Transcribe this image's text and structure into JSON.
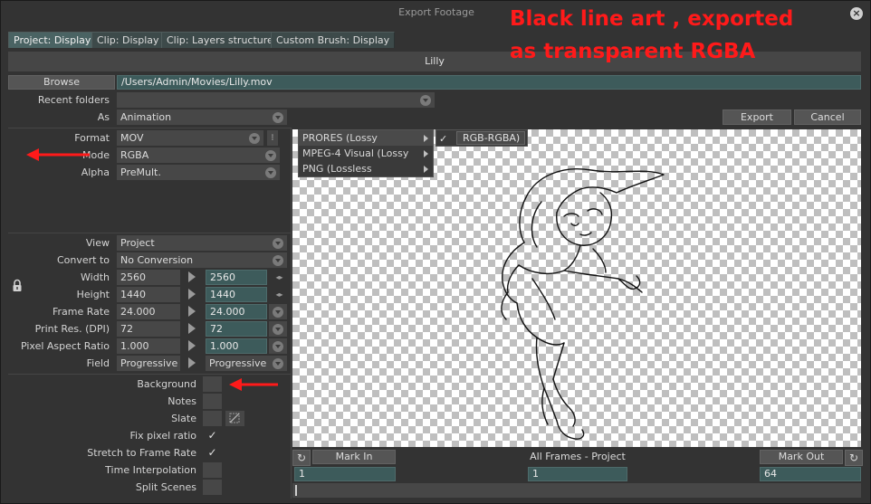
{
  "window": {
    "title": "Export Footage"
  },
  "overlay": {
    "line1": "Black line art , exported",
    "line2": "as transparent RGBA",
    "color": "#ff1a1a"
  },
  "tabs": [
    {
      "label": "Project: Display",
      "active": true
    },
    {
      "label": "Clip: Display",
      "active": false
    },
    {
      "label": "Clip: Layers structure",
      "active": false
    },
    {
      "label": "Custom Brush: Display",
      "active": false
    }
  ],
  "clip_name": "Lilly",
  "browse": {
    "label": "Browse",
    "path": "/Users/Admin/Movies/Lilly.mov"
  },
  "recent_folders": {
    "label": "Recent folders",
    "value": ""
  },
  "as": {
    "label": "As",
    "value": "Animation"
  },
  "buttons": {
    "export": "Export",
    "cancel": "Cancel"
  },
  "format": {
    "label": "Format",
    "value": "MOV"
  },
  "mode": {
    "label": "Mode",
    "value": "RGBA"
  },
  "alpha": {
    "label": "Alpha",
    "value": "PreMult."
  },
  "codec_menu": [
    {
      "label": "PRORES (Lossy",
      "has_sub": true,
      "highlighted": true
    },
    {
      "label": "MPEG-4 Visual (Lossy",
      "has_sub": true,
      "highlighted": false
    },
    {
      "label": "PNG (Lossless",
      "has_sub": true,
      "highlighted": false
    }
  ],
  "codec_submenu": {
    "check": "✓",
    "label": "RGB-RGBA)"
  },
  "view": {
    "label": "View",
    "value": "Project"
  },
  "convert_to": {
    "label": "Convert to",
    "value": "No Conversion"
  },
  "params": [
    {
      "label": "Width",
      "src": "2560",
      "dst": "2560",
      "control": "spin"
    },
    {
      "label": "Height",
      "src": "1440",
      "dst": "1440",
      "control": "spin"
    },
    {
      "label": "Frame Rate",
      "src": "24.000",
      "dst": "24.000",
      "control": "dropdown"
    },
    {
      "label": "Print Res. (DPI)",
      "src": "72",
      "dst": "72",
      "control": "dropdown"
    },
    {
      "label": "Pixel Aspect Ratio",
      "src": "1.000",
      "dst": "1.000",
      "control": "dropdown"
    },
    {
      "label": "Field",
      "src": "Progressive",
      "dst": "Progressive",
      "control": "dropdown"
    }
  ],
  "options": [
    {
      "label": "Background",
      "checked": false
    },
    {
      "label": "Notes",
      "checked": false
    },
    {
      "label": "Slate",
      "checked": false
    },
    {
      "label": "Fix pixel ratio",
      "checked": true
    },
    {
      "label": "Stretch to Frame Rate",
      "checked": true
    },
    {
      "label": "Time Interpolation",
      "checked": false
    },
    {
      "label": "Split Scenes",
      "checked": false
    }
  ],
  "check_glyph": "✓",
  "range": {
    "mark_in_label": "Mark In",
    "mark_in_value": "1",
    "all_frames_label": "All Frames - Project",
    "all_frames_value": "1",
    "mark_out_label": "Mark Out",
    "mark_out_value": "64"
  },
  "icons": {
    "close": "×",
    "refresh": "↻"
  }
}
